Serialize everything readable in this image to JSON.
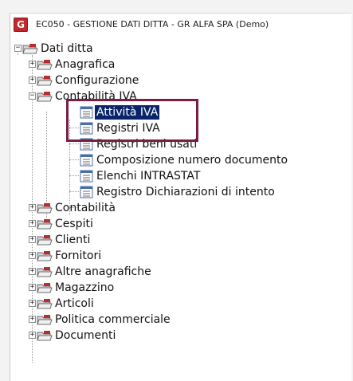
{
  "window": {
    "title": "EC050 - GESTIONE DATI DITTA - GR ALFA SPA  (Demo)",
    "app_icon_glyph": "G",
    "accent_color": "#c0282d"
  },
  "tree": {
    "root": {
      "label": "Dati ditta",
      "expanded": true
    },
    "anagrafica": {
      "label": "Anagrafica"
    },
    "configurazione": {
      "label": "Configurazione"
    },
    "contabilita_iva": {
      "label": "Contabilità IVA",
      "expanded": true,
      "children": {
        "attivita_iva": "Attività IVA",
        "registri_iva": "Registri IVA",
        "registri_beni_usati": "Registri beni usati",
        "composizione_numero_documento": "Composizione numero documento",
        "elenchi_intrastat": "Elenchi INTRASTAT",
        "registro_dichiarazioni": "Registro Dichiarazioni di intento"
      }
    },
    "contabilita": {
      "label": "Contabilità"
    },
    "cespiti": {
      "label": "Cespiti"
    },
    "clienti": {
      "label": "Clienti"
    },
    "fornitori": {
      "label": "Fornitori"
    },
    "altre_anagrafiche": {
      "label": "Altre anagrafiche"
    },
    "magazzino": {
      "label": "Magazzino"
    },
    "articoli": {
      "label": "Articoli"
    },
    "politica_commerciale": {
      "label": "Politica commerciale"
    },
    "documenti": {
      "label": "Documenti"
    },
    "selected_item": "Attività IVA",
    "highlight_color": "#7a1f43",
    "selection_color": "#0a246a",
    "icons": {
      "folder": "folder-icon",
      "document": "document-icon"
    },
    "expander_symbols": {
      "collapsed": "+",
      "expanded": "−"
    }
  }
}
